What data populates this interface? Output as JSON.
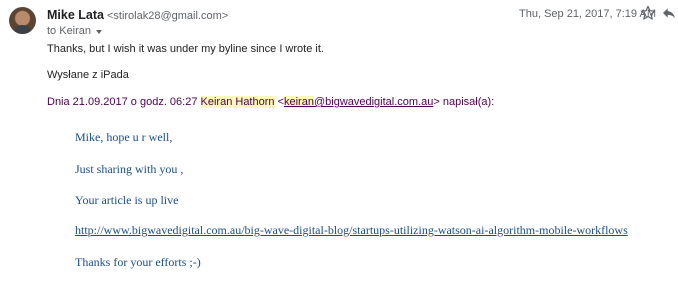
{
  "sender": {
    "name": "Mike Lata",
    "email": "<stirolak28@gmail.com>",
    "to_label": "to Keiran"
  },
  "date": "Thu, Sep 21, 2017, 7:19 AM",
  "icons": {
    "avatar": "avatar",
    "star": "star-icon",
    "reply": "reply-icon",
    "recipient_dropdown": "chevron-down-icon"
  },
  "body": {
    "line1": "Thanks, but I wish it was under my byline since I wrote it.",
    "line2": "Wysłane z iPada"
  },
  "quote_header": {
    "prefix": "Dnia 21.09.2017 o godz. 06:27 ",
    "name": "Keiran Hathorn",
    "lt": " <",
    "email_user": "keiran",
    "email_domain": "@bigwavedigital.com.au",
    "suffix": "> napisał(a):"
  },
  "quoted": {
    "line1": "Mike, hope u r well,",
    "line2": "Just sharing with you ,",
    "line3": "Your article is up live",
    "link": "http://www.bigwavedigital.com.au/big-wave-digital-blog/startups-utilizing-watson-ai-algorithm-mobile-workflows",
    "line5": "Thanks for your efforts ;-)"
  },
  "colors": {
    "quote_header": "#500050",
    "quoted_text": "#1a4d8a",
    "highlight": "#fcf8bc"
  }
}
